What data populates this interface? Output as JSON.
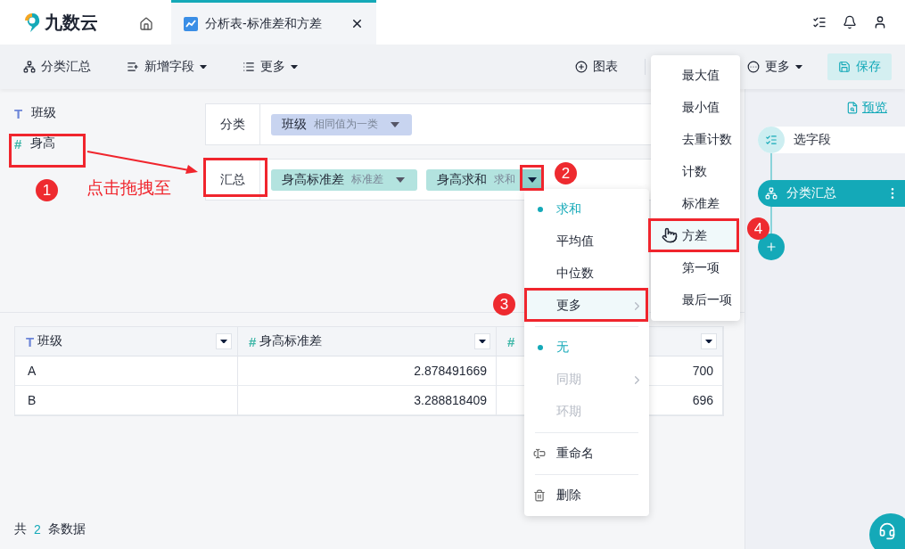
{
  "app": {
    "name": "九数云"
  },
  "tabs": [
    {
      "kind": "home",
      "selected": false
    },
    {
      "kind": "sheet",
      "label": "分析表-标准差和方差",
      "selected": true
    }
  ],
  "toolbar": {
    "left": [
      {
        "label": "分类汇总",
        "dropdown": false
      },
      {
        "label": "新增字段",
        "dropdown": true
      },
      {
        "label": "更多",
        "dropdown": true
      }
    ],
    "right": [
      {
        "label": "图表",
        "dropdown": false,
        "kind": "plain"
      },
      {
        "label": "更多",
        "dropdown": true,
        "kind": "plain"
      },
      {
        "label": "保存",
        "dropdown": false,
        "kind": "primary"
      }
    ]
  },
  "fields": [
    {
      "label": "班级",
      "mark": "T",
      "kind": "text"
    },
    {
      "label": "身高",
      "mark": "#",
      "kind": "number"
    }
  ],
  "config": [
    {
      "label": "分类",
      "chips": [
        {
          "label": "班级",
          "agg": "相同值为一类",
          "kind": "text",
          "active": false
        }
      ]
    },
    {
      "label": "汇总",
      "chips": [
        {
          "label": "身高标准差",
          "agg": "标准差",
          "kind": "number",
          "active": false
        },
        {
          "label": "身高求和",
          "agg": "求和",
          "kind": "number",
          "active": true
        }
      ]
    }
  ],
  "table": {
    "columns": [
      {
        "label": "班级",
        "mark": "T",
        "kind": "text"
      },
      {
        "label": "身高标准差",
        "mark": "#",
        "kind": "number"
      },
      {
        "mark": "#",
        "kind": "number"
      }
    ],
    "rows": [
      [
        "A",
        "2.878491669",
        "700"
      ],
      [
        "B",
        "3.288818409",
        "696"
      ]
    ]
  },
  "footer": {
    "prefix": "共",
    "count": "2",
    "suffix": "条数据"
  },
  "panel": {
    "preview": "预览",
    "steps": [
      {
        "label": "选字段",
        "selected": false
      },
      {
        "label": "分类汇总",
        "selected": true
      }
    ]
  },
  "agg_menu": {
    "groups": [
      {
        "items": [
          {
            "label": "求和",
            "kind": "option",
            "selected": true,
            "hovered": false,
            "disabled": false
          },
          {
            "label": "平均值",
            "kind": "option",
            "selected": false,
            "hovered": false,
            "disabled": false
          },
          {
            "label": "中位数",
            "kind": "option",
            "selected": false,
            "hovered": false,
            "disabled": false
          },
          {
            "label": "更多",
            "kind": "submenu",
            "selected": false,
            "hovered": true,
            "disabled": false
          }
        ]
      },
      {
        "items": [
          {
            "label": "无",
            "kind": "option",
            "selected": true,
            "hovered": false,
            "disabled": false
          },
          {
            "label": "同期",
            "kind": "submenu",
            "selected": false,
            "hovered": false,
            "disabled": true
          },
          {
            "label": "环期",
            "kind": "option",
            "selected": false,
            "hovered": false,
            "disabled": true
          }
        ]
      },
      {
        "items": [
          {
            "label": "重命名",
            "kind": "rename",
            "selected": false,
            "hovered": false,
            "disabled": false
          }
        ]
      },
      {
        "items": [
          {
            "label": "删除",
            "kind": "delete",
            "selected": false,
            "hovered": false,
            "disabled": false
          }
        ]
      }
    ]
  },
  "more_menu": {
    "items": [
      {
        "label": "最大值",
        "hovered": false
      },
      {
        "label": "最小值",
        "hovered": false
      },
      {
        "label": "去重计数",
        "hovered": false
      },
      {
        "label": "计数",
        "hovered": false
      },
      {
        "label": "标准差",
        "hovered": false
      },
      {
        "label": "方差",
        "hovered": true
      },
      {
        "label": "第一项",
        "hovered": false
      },
      {
        "label": "最后一项",
        "hovered": false
      }
    ]
  },
  "annotations": {
    "badges": [
      "1",
      "2",
      "3",
      "4"
    ],
    "caption": "点击拖拽至"
  }
}
